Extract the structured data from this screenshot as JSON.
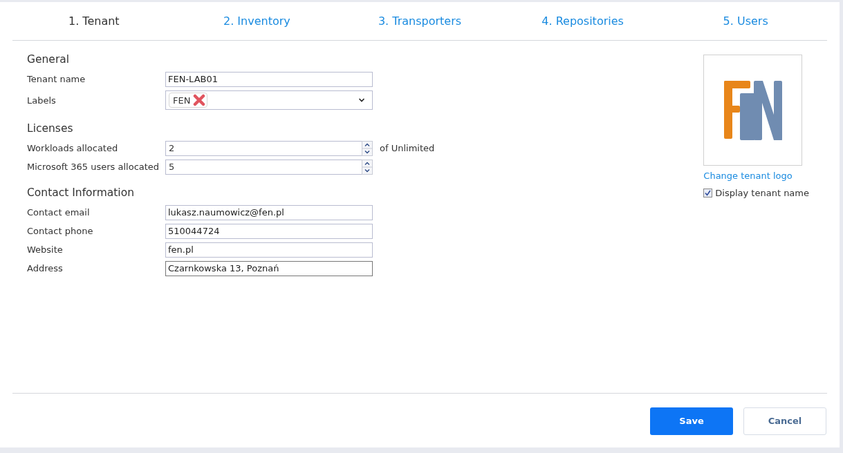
{
  "tabs": [
    {
      "label": "1. Tenant",
      "selected": true
    },
    {
      "label": "2. Inventory",
      "selected": false
    },
    {
      "label": "3. Transporters",
      "selected": false
    },
    {
      "label": "4. Repositories",
      "selected": false
    },
    {
      "label": "5. Users",
      "selected": false
    }
  ],
  "sections": [
    {
      "title": "General",
      "fields": [
        {
          "kind": "text",
          "label": "Tenant name",
          "value": "FEN-LAB01"
        },
        {
          "kind": "tags",
          "label": "Labels",
          "tags": [
            "FEN"
          ]
        }
      ]
    },
    {
      "title": "Licenses",
      "fields": [
        {
          "kind": "number",
          "label": "Workloads allocated",
          "value": "2",
          "suffix": "of Unlimited"
        },
        {
          "kind": "number",
          "label": "Microsoft 365 users allocated",
          "value": "5"
        }
      ]
    },
    {
      "title": "Contact Information",
      "fields": [
        {
          "kind": "text",
          "label": "Contact email",
          "value": "lukasz.naumowicz@fen.pl"
        },
        {
          "kind": "text",
          "label": "Contact phone",
          "value": "510044724"
        },
        {
          "kind": "text",
          "label": "Website",
          "value": "fen.pl"
        },
        {
          "kind": "text",
          "label": "Address",
          "value": "Czarnkowska 13, Poznań",
          "focused": true
        }
      ]
    }
  ],
  "logo": {
    "change_link": "Change tenant logo",
    "display_name": {
      "label": "Display tenant name",
      "checked": true
    }
  },
  "buttons": [
    {
      "label": "Save",
      "kind": "primary"
    },
    {
      "label": "Cancel",
      "kind": "secondary"
    }
  ]
}
